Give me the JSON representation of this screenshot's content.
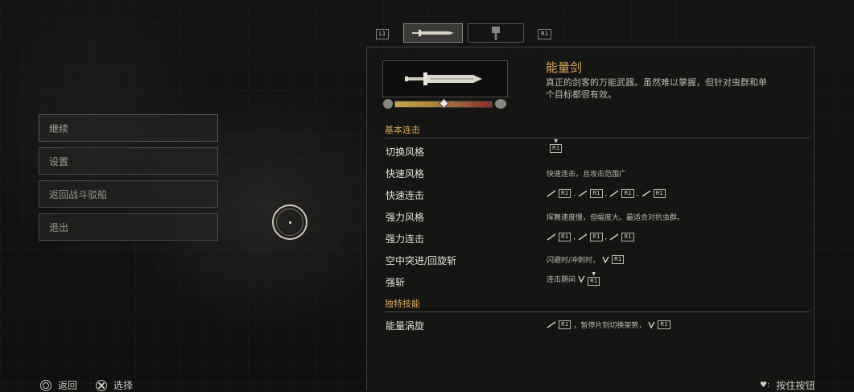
{
  "menu": {
    "items": [
      {
        "label": "继续"
      },
      {
        "label": "设置"
      },
      {
        "label": "返回战斗驳船"
      },
      {
        "label": "退出"
      }
    ]
  },
  "tabs": {
    "left_button": "L1",
    "right_button": "R1"
  },
  "weapon": {
    "name": "能量剑",
    "description": "真正的剑客的万能武器。虽然难以掌握，但针对虫群和单个目标都很有效。",
    "balance_level": 0.5
  },
  "sections": {
    "basic": "基本连击",
    "special": "独特技能"
  },
  "moves": [
    {
      "label": "切换风格",
      "text": ""
    },
    {
      "label": "快速风格",
      "text": "快速连击，且攻击范围广"
    },
    {
      "label": "快速连击",
      "text": ""
    },
    {
      "label": "强力风格",
      "text": "挥舞速度慢，但幅度大。最适合对抗虫群。"
    },
    {
      "label": "强力连击",
      "text": ""
    },
    {
      "label": "空中突进/回旋斩",
      "text": "闪避时/冲刺时，"
    },
    {
      "label": "强斩",
      "text": "连击期间"
    }
  ],
  "special_moves": [
    {
      "label": "能量涡旋",
      "text_a": "，暂停片刻切换架势，"
    }
  ],
  "button_labels": {
    "r1": "R1"
  },
  "hints": {
    "back": "返回",
    "select": "选择",
    "hold": "按住按钮"
  },
  "colors": {
    "accent": "#d9a657",
    "text": "#e4e0d6"
  }
}
